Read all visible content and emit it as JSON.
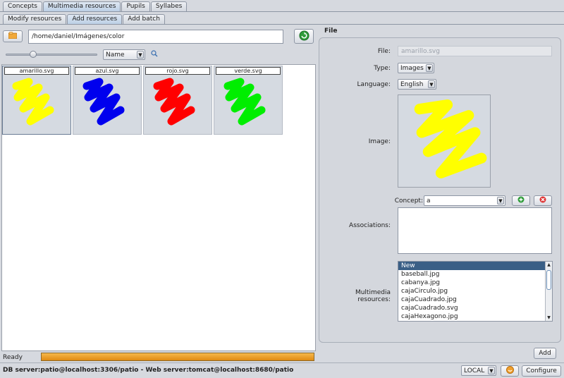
{
  "top_tabs": [
    "Concepts",
    "Multimedia resources",
    "Pupils",
    "Syllabes"
  ],
  "sub_tabs": [
    "Modify resources",
    "Add resources",
    "Add batch"
  ],
  "path": "/home/daniel/Imágenes/color",
  "sort": "Name",
  "thumbnails": [
    {
      "name": "amarillo.svg",
      "color": "#ffff00"
    },
    {
      "name": "azul.svg",
      "color": "#0000ee"
    },
    {
      "name": "rojo.svg",
      "color": "#ff0000"
    },
    {
      "name": "verde.svg",
      "color": "#00ee00"
    }
  ],
  "status_text": "Ready",
  "progress": 1.0,
  "progress_color": "#f0a020",
  "form": {
    "group_title": "File",
    "file_label": "File:",
    "file_value": "amarillo.svg",
    "type_label": "Type:",
    "type_value": "Images",
    "language_label": "Language:",
    "language_value": "English",
    "image_label": "Image:",
    "image_color": "#ffff00",
    "concept_label": "Concept:",
    "concept_value": "a",
    "associations_label": "Associations:",
    "multimedia_label": "Multimedia resources:",
    "multimedia_items": [
      "New",
      "baseball.jpg",
      "cabanya.jpg",
      "cajaCirculo.jpg",
      "cajaCuadrado.jpg",
      "cajaCuadrado.svg",
      "cajaHexagono.jpg"
    ],
    "add_label": "Add"
  },
  "footer": {
    "server_text": "DB server:patio@localhost:3306/patio - Web server:tomcat@localhost:8680/patio",
    "mode": "LOCAL",
    "configure_label": "Configure"
  }
}
